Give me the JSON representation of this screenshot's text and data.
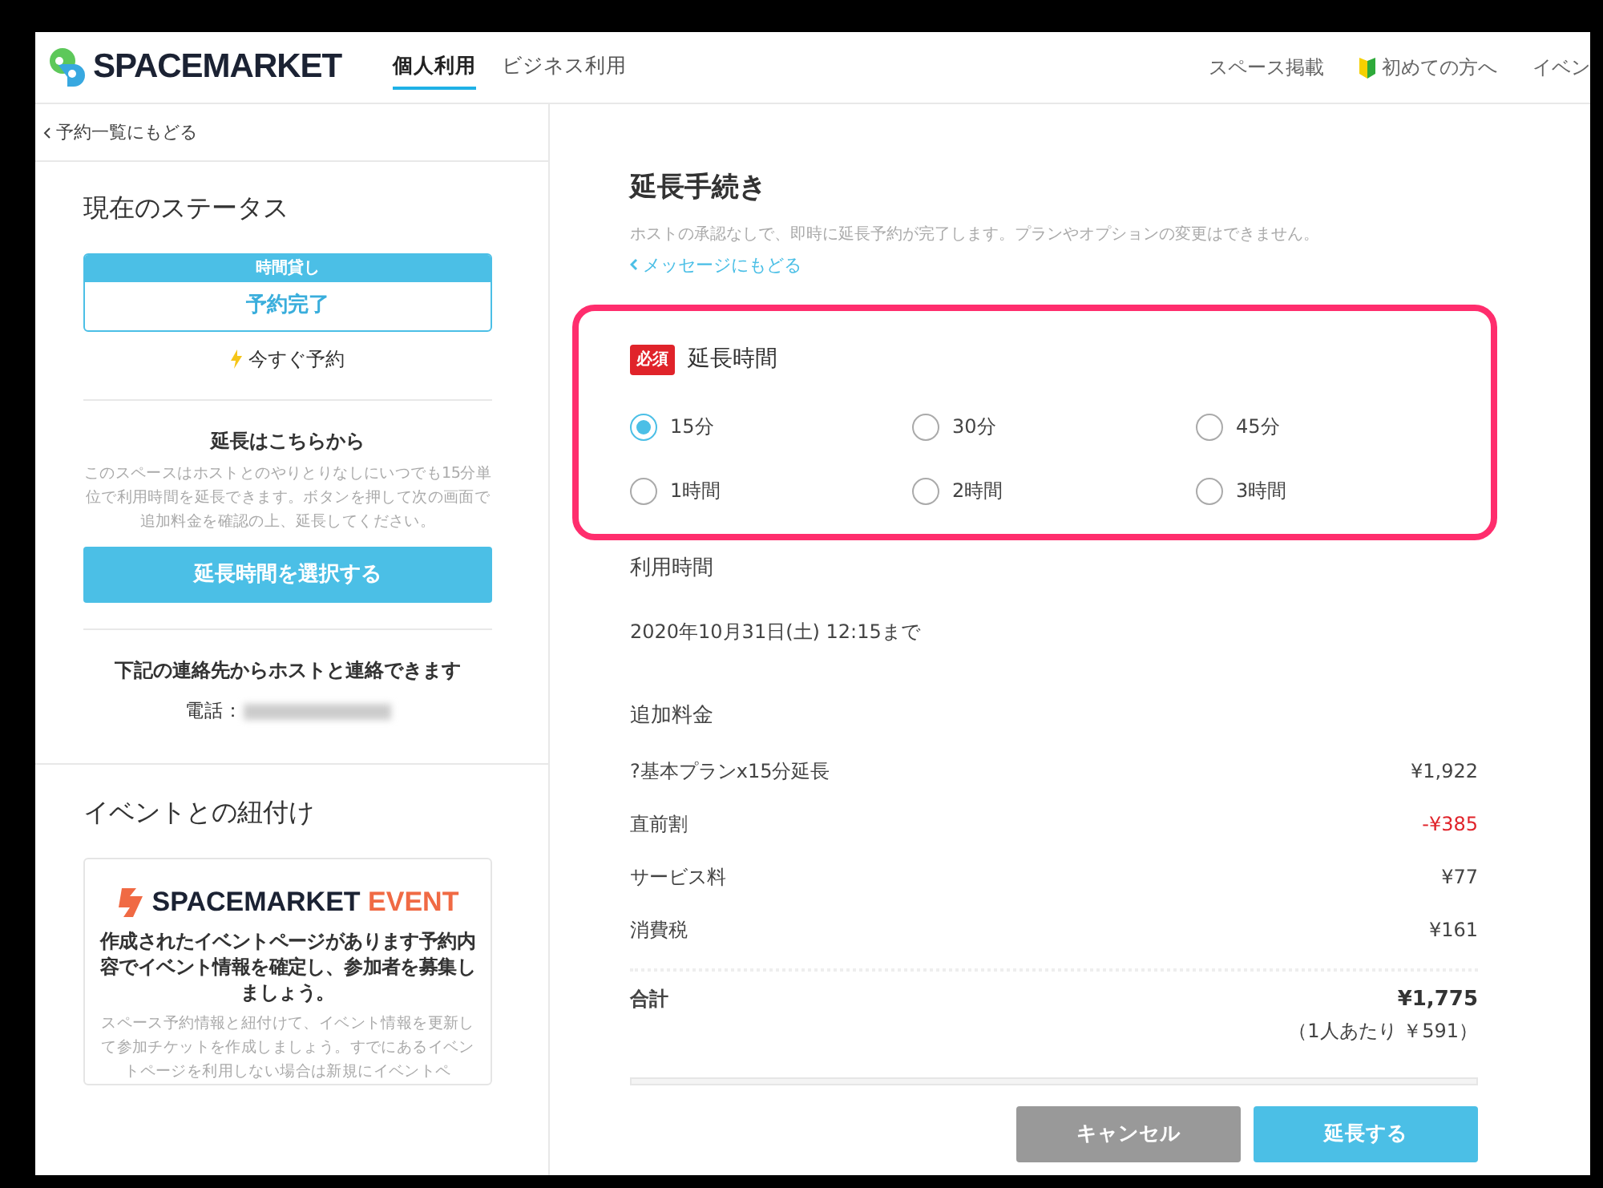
{
  "header": {
    "logo_text": "SPACEMARKET",
    "tabs": [
      {
        "label": "個人利用",
        "selected": true
      },
      {
        "label": "ビジネス利用",
        "selected": false
      }
    ],
    "links": [
      {
        "label": "スペース掲載",
        "kind": "plain"
      },
      {
        "label": "初めての方へ",
        "kind": "beginner"
      },
      {
        "label": "イベン",
        "kind": "plain"
      }
    ]
  },
  "sidebar": {
    "back_link": "予約一覧にもどる",
    "status": {
      "title": "現在のステータス",
      "plan_label": "時間貸し",
      "status": "予約完了",
      "booking_type": "今すぐ予約"
    },
    "extension": {
      "title": "延長はこちらから",
      "description": "このスペースはホストとのやりとりなしにいつでも15分単位で利用時間を延長できます。ボタンを押して次の画面で追加料金を確認の上、延長してください。",
      "button": "延長時間を選択する"
    },
    "contact": {
      "title": "下記の連絡先からホストと連絡できます",
      "phone_label": "電話："
    },
    "event": {
      "title": "イベントとの紐付け",
      "logo_text": "SPACEMARKET",
      "logo_accent": "EVENT",
      "heading": "作成されたイベントページがあります予約内容でイベント情報を確定し、参加者を募集しましょう。",
      "description": "スペース予約情報と紐付けて、イベント情報を更新して参加チケットを作成しましょう。すでにあるイベントページを利用しない場合は新規にイベントペ"
    }
  },
  "main": {
    "title": "延長手続き",
    "note": "ホストの承認なしで、即時に延長予約が完了します。プランやオプションの変更はできません。",
    "back_link": "メッセージにもどる",
    "duration": {
      "required_badge": "必須",
      "label": "延長時間",
      "options": [
        {
          "label": "15分",
          "selected": true
        },
        {
          "label": "30分",
          "selected": false
        },
        {
          "label": "45分",
          "selected": false
        },
        {
          "label": "1時間",
          "selected": false
        },
        {
          "label": "2時間",
          "selected": false
        },
        {
          "label": "3時間",
          "selected": false
        }
      ]
    },
    "usage": {
      "label": "利用時間",
      "value": "2020年10月31日(土) 12:15まで"
    },
    "fees": {
      "label": "追加料金",
      "rows": [
        {
          "label": "?基本プランx15分延長",
          "amount": "¥1,922",
          "kind": "normal"
        },
        {
          "label": "直前割",
          "amount": "-¥385",
          "kind": "discount"
        },
        {
          "label": "サービス料",
          "amount": "¥77",
          "kind": "normal"
        },
        {
          "label": "消費税",
          "amount": "¥161",
          "kind": "normal"
        }
      ],
      "total_label": "合計",
      "total_amount": "¥1,775",
      "per_person": "（1人あたり ￥591）"
    },
    "buttons": {
      "cancel": "キャンセル",
      "confirm": "延長する"
    }
  }
}
